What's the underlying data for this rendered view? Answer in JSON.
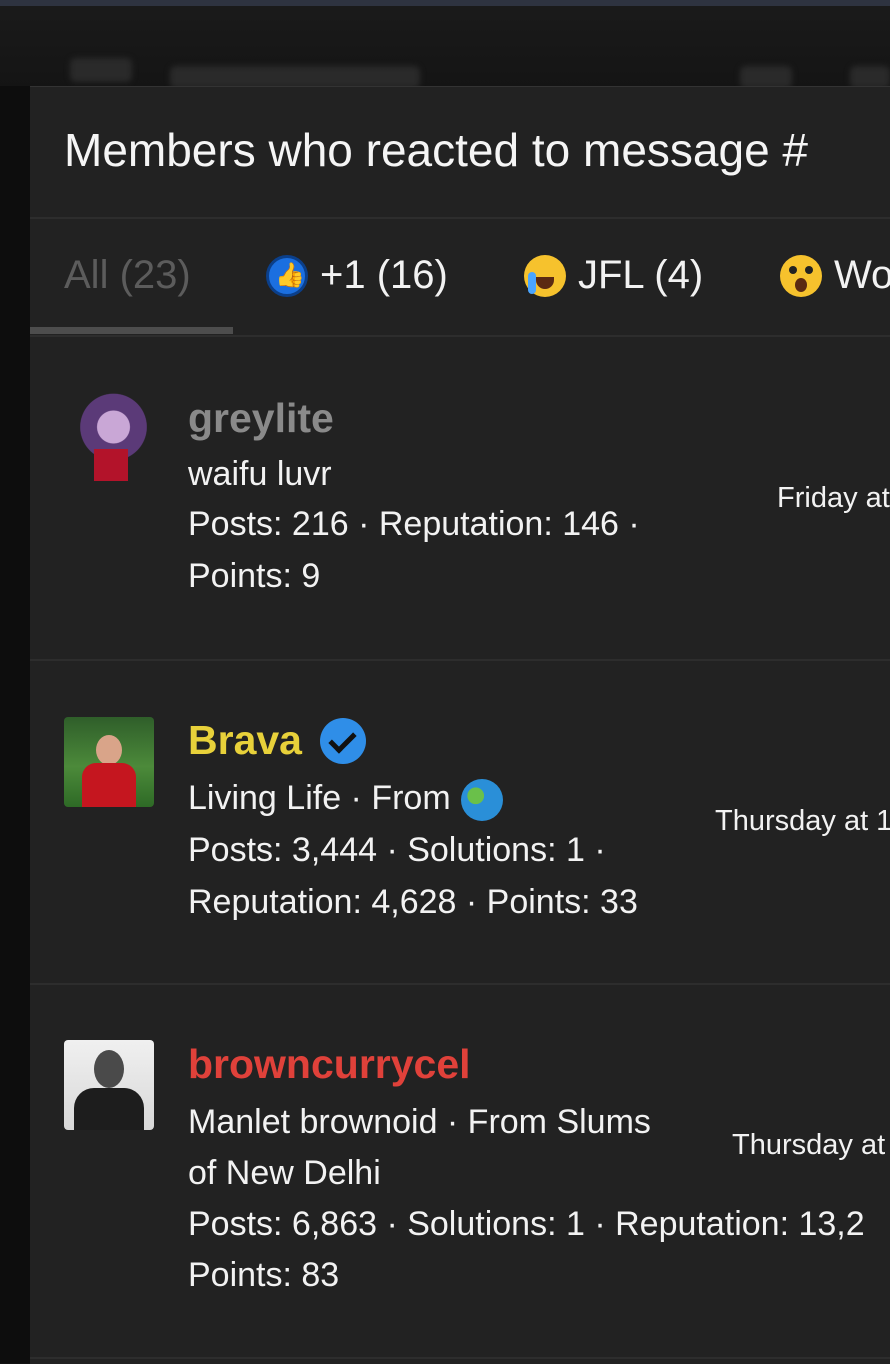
{
  "dialog": {
    "title": "Members who reacted to message #"
  },
  "tabs": [
    {
      "label": "All (23)",
      "icon": null,
      "active": true
    },
    {
      "label": "+1 (16)",
      "icon": "thumbs-up-icon"
    },
    {
      "label": "JFL (4)",
      "icon": "laughing-crying-icon"
    },
    {
      "label": "Wo",
      "icon": "astonished-face-icon"
    }
  ],
  "members": [
    {
      "username": "greylite",
      "username_color": "#8a8a8a",
      "title": "waifu luvr",
      "stats_line1": "Posts: 216 · Reputation: 146 ·",
      "stats_line2": "Points: 9",
      "date": "Friday at"
    },
    {
      "username": "Brava",
      "username_color": "#e8d13a",
      "verified": true,
      "title": "Living Life · From",
      "title_icon": "globe-icon",
      "stats_line1": "Posts: 3,444 · Solutions: 1 ·",
      "stats_line2": "Reputation: 4,628 · Points: 33",
      "date": "Thursday at 1"
    },
    {
      "username": "browncurrycel",
      "username_color": "#e0413a",
      "title": "Manlet brownoid · From Slums",
      "title_line2": "of New Delhi",
      "stats_line1": "Posts: 6,863 · Solutions: 1 · Reputation: 13,2",
      "stats_line2": "Points: 83",
      "date": "Thursday at"
    }
  ]
}
